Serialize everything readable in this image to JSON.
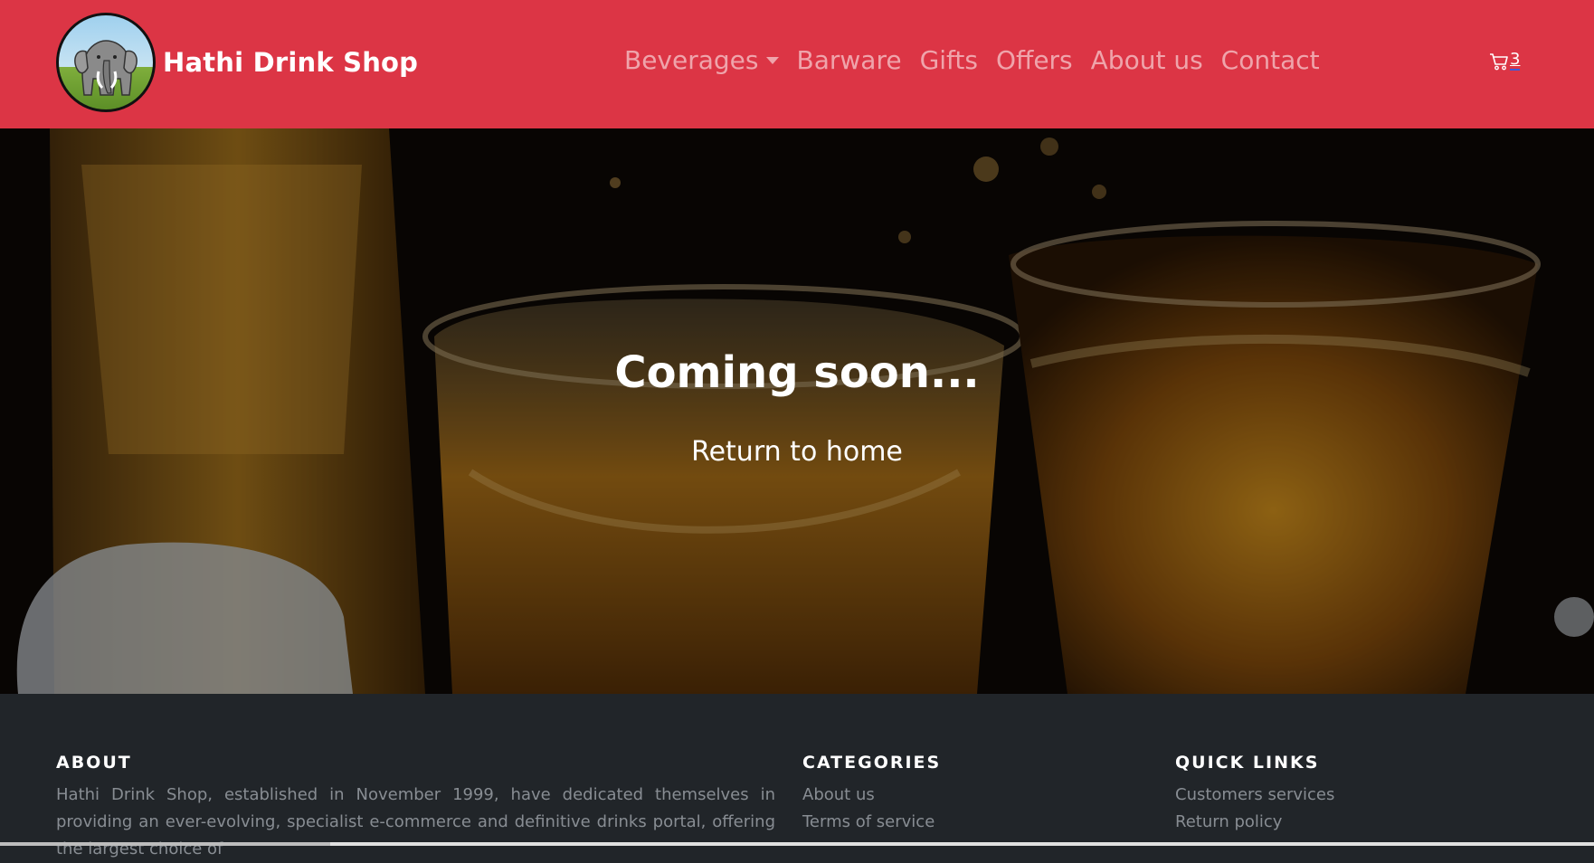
{
  "brand": {
    "name": "Hathi Drink Shop",
    "logo_icon": "elephant-logo-icon"
  },
  "nav": {
    "items": [
      {
        "label": "Beverages",
        "has_dropdown": true
      },
      {
        "label": "Barware"
      },
      {
        "label": "Gifts"
      },
      {
        "label": "Offers"
      },
      {
        "label": "About us"
      },
      {
        "label": "Contact"
      }
    ],
    "cart": {
      "icon": "cart-icon",
      "count": "3"
    }
  },
  "hero": {
    "title": "Coming soon...",
    "link": "Return to home"
  },
  "footer": {
    "about": {
      "heading": "ABOUT",
      "text": "Hathi Drink Shop, established in November 1999, have dedicated themselves in providing an ever-evolving, specialist e-commerce and definitive drinks portal, offering the largest choice of"
    },
    "categories": {
      "heading": "CATEGORIES",
      "links": [
        "About us",
        "Terms of service"
      ]
    },
    "quick_links": {
      "heading": "QUICK LINKS",
      "links": [
        "Customers services",
        "Return policy"
      ]
    }
  },
  "colors": {
    "navbar": "#dc3545",
    "footer": "#212529",
    "muted_text": "#888d93"
  }
}
